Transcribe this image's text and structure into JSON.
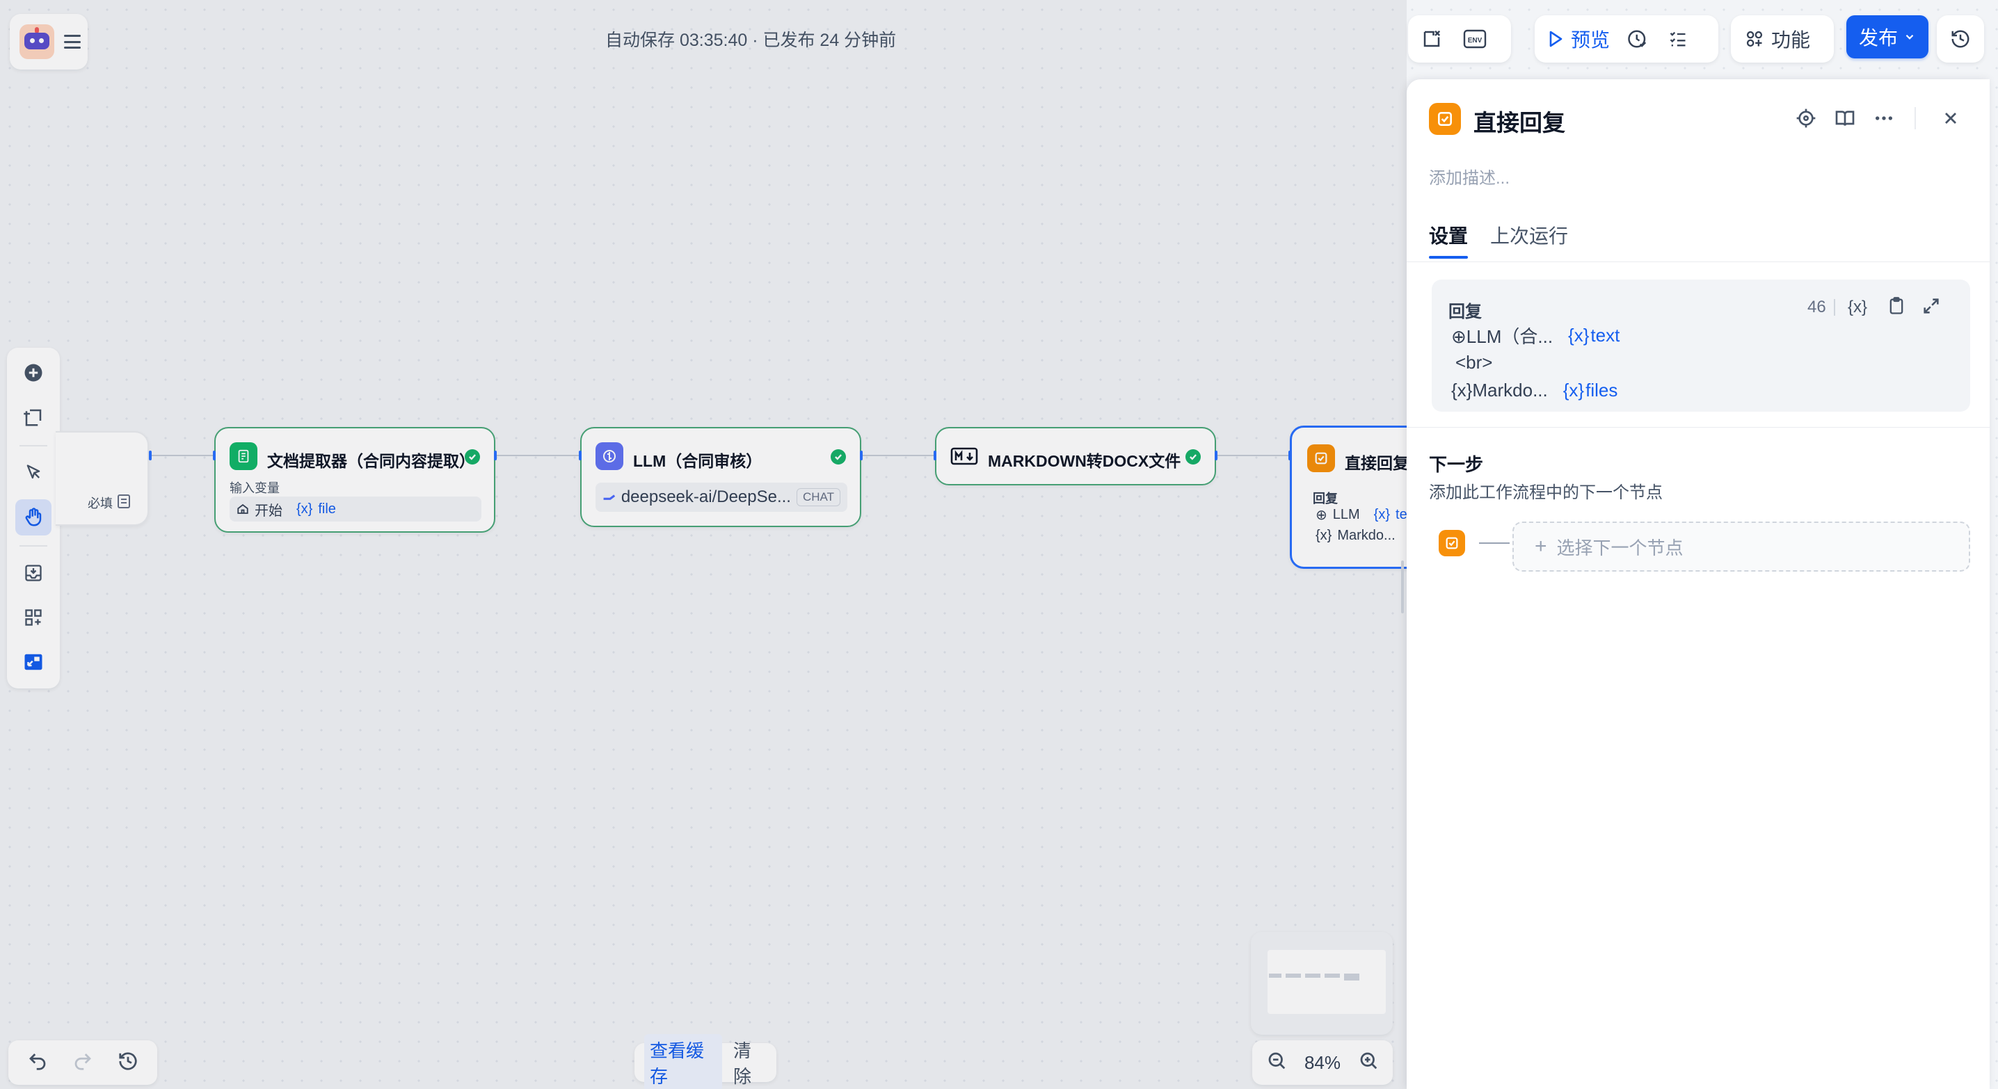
{
  "header": {
    "autosave_text": "自动保存 03:35:40 · 已发布 24 分钟前",
    "preview_label": "预览",
    "features_label": "功能",
    "publish_label": "发布",
    "env_label": "ENV"
  },
  "canvas": {
    "start_node": {
      "required_label": "必填"
    },
    "nodes": [
      {
        "title": "文档提取器（合同内容提取）",
        "input_label": "输入变量",
        "input_source": "开始",
        "input_var": "file"
      },
      {
        "title": "LLM（合同审核）",
        "model": "deepseek-ai/DeepSe...",
        "model_tag": "CHAT"
      },
      {
        "title": "MARKDOWN转DOCX文件"
      },
      {
        "title": "直接回复",
        "section_label": "回复",
        "line1_source": "LLM",
        "line1_var": "tex",
        "line2_source": "Markdo..."
      }
    ]
  },
  "panel": {
    "title": "直接回复",
    "description_placeholder": "添加描述...",
    "tabs": [
      "设置",
      "上次运行"
    ],
    "reply": {
      "label": "回复",
      "count": "46",
      "var_icon": "{x}",
      "line1_source": "LLM（合...",
      "line1_var": "text",
      "line2": "<br>",
      "line3_source": "Markdo...",
      "line3_var": "files"
    },
    "next_step": {
      "title": "下一步",
      "subtitle": "添加此工作流程中的下一个节点",
      "select_placeholder": "选择下一个节点"
    }
  },
  "footer": {
    "view_cache": "查看缓存",
    "clear": "清除",
    "zoom": "84%"
  },
  "colors": {
    "accent": "#155eef",
    "success": "#17b26a",
    "reply_orange": "#f79009",
    "node_border": "#4aa87a"
  }
}
